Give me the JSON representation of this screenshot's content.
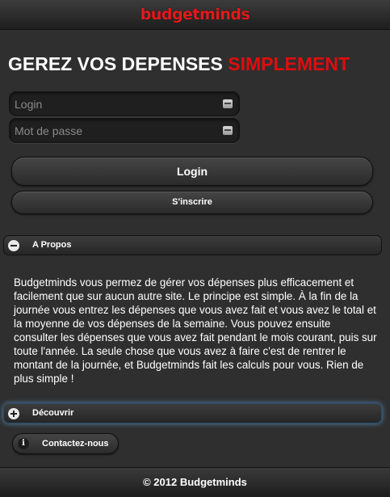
{
  "header": {
    "logo": "budgetminds"
  },
  "headline": {
    "part1": "GEREZ VOS DEPENSES ",
    "part2": "SIMPLEMENT"
  },
  "form": {
    "login_placeholder": "Login",
    "password_placeholder": "Mot de passe",
    "login_button": "Login",
    "signup_button": "S'inscrire"
  },
  "about": {
    "title": "A Propos",
    "text": "Budgetminds vous permez de gérer vos dépenses plus efficacement et facilement que sur aucun autre site. Le principe est simple. À la fin de la journée vous entrez les dépenses que vous avez fait et vous avez le total et la moyenne de vos dépenses de la semaine. Vous pouvez ensuite consulter les dépenses que vous avez fait pendant le mois courant, puis sur toute l'année. La seule chose que vous avez à faire c'est de rentrer le montant de la journée, et Budgetminds fait les calculs pour vous. Rien de plus simple !"
  },
  "discover": {
    "title": "Découvrir"
  },
  "contact": {
    "label": "Contactez-nous",
    "icon": "info-icon"
  },
  "footer": {
    "text": "© 2012 Budgetminds"
  },
  "icons": {
    "about": "minus-icon",
    "discover": "plus-icon",
    "fields": "keyboard-icon"
  },
  "colors": {
    "brand_red": "#e21b1b",
    "background": "#2f2f2f"
  }
}
